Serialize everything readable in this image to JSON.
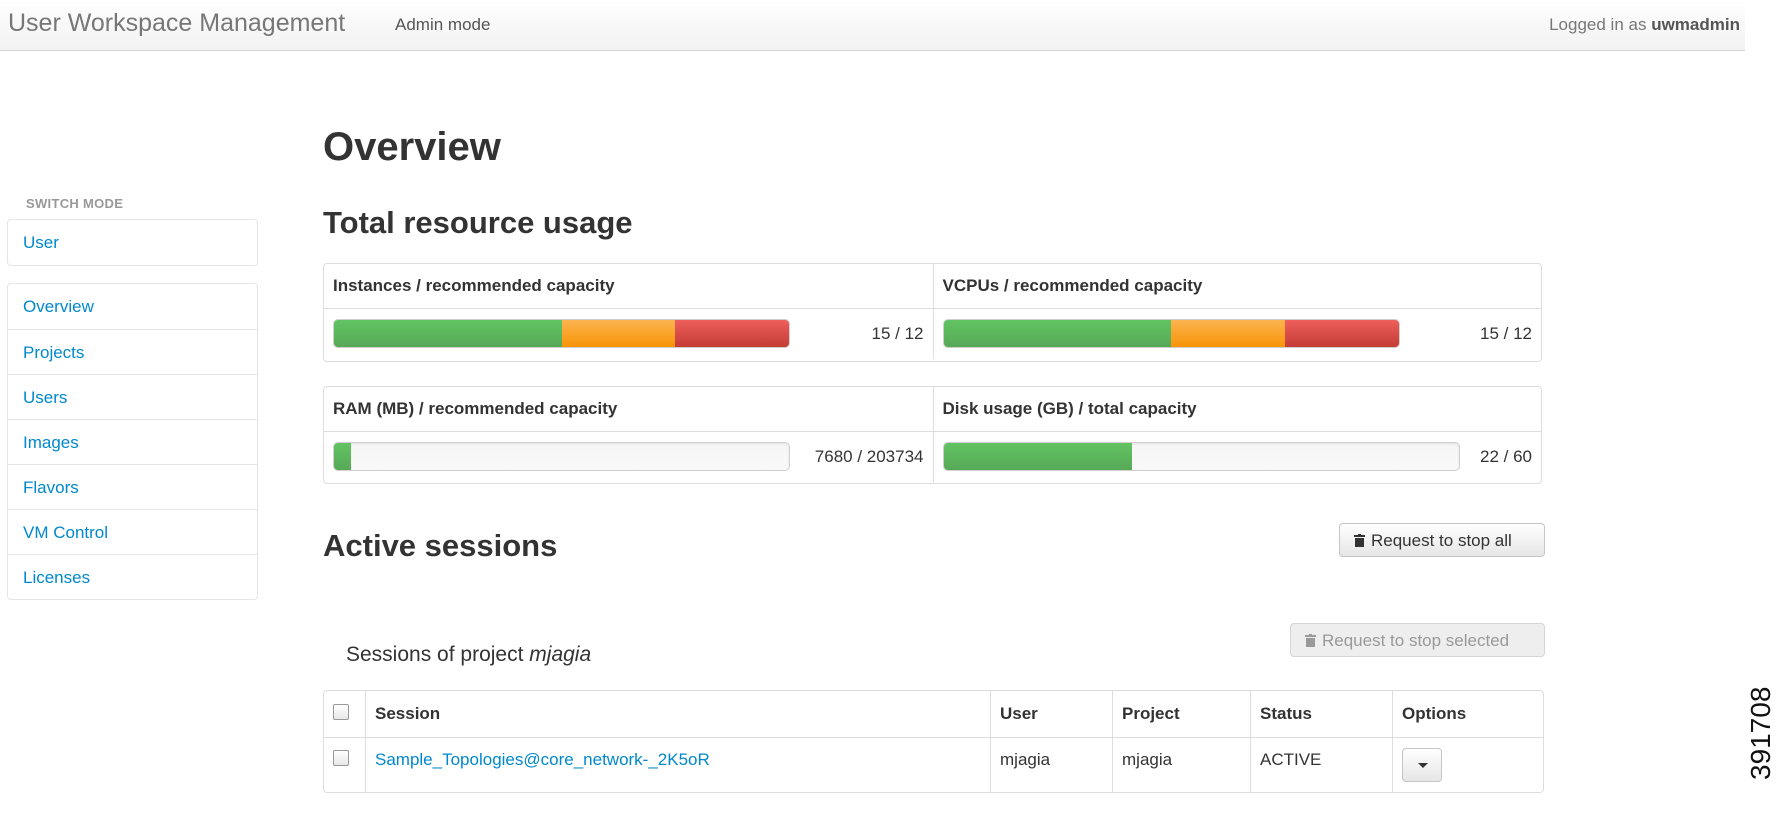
{
  "header": {
    "brand": "User Workspace Management",
    "mode": "Admin mode",
    "login_prefix": "Logged in as",
    "username": "uwmadmin"
  },
  "sidebar": {
    "switch_header": "SWITCH MODE",
    "switch_items": [
      {
        "label": "User"
      }
    ],
    "items": [
      {
        "label": "Overview"
      },
      {
        "label": "Projects"
      },
      {
        "label": "Users"
      },
      {
        "label": "Images"
      },
      {
        "label": "Flavors"
      },
      {
        "label": "VM Control"
      },
      {
        "label": "Licenses"
      }
    ]
  },
  "main": {
    "title": "Overview",
    "usage_title": "Total resource usage",
    "usage": [
      {
        "label": "Instances / recommended capacity",
        "value": "15 / 12",
        "segments": {
          "green": 0.5,
          "orange": 0.25,
          "red": 0.25
        }
      },
      {
        "label": "VCPUs / recommended capacity",
        "value": "15 / 12",
        "segments": {
          "green": 0.5,
          "orange": 0.25,
          "red": 0.25
        }
      },
      {
        "label": "RAM (MB) / recommended capacity",
        "value": "7680 / 203734",
        "segments": {
          "green": 0.0377,
          "orange": 0,
          "red": 0
        }
      },
      {
        "label": "Disk usage (GB) / total capacity",
        "value": "22 / 60",
        "segments": {
          "green": 0.3667,
          "orange": 0,
          "red": 0
        }
      }
    ],
    "active_title": "Active sessions",
    "stop_all_label": "Request to stop all",
    "stop_selected_label": "Request to stop selected",
    "sessions_prefix": "Sessions of project",
    "sessions_project": "mjagia",
    "table": {
      "columns": [
        "Session",
        "User",
        "Project",
        "Status",
        "Options"
      ],
      "rows": [
        {
          "session": "Sample_Topologies@core_network-_2K5oR",
          "user": "mjagia",
          "project": "mjagia",
          "status": "ACTIVE"
        }
      ]
    }
  },
  "figure_id": "391708",
  "colors": {
    "link": "#0088cc",
    "green": "#5eb95e",
    "orange": "#f89406",
    "red": "#dd514c"
  }
}
